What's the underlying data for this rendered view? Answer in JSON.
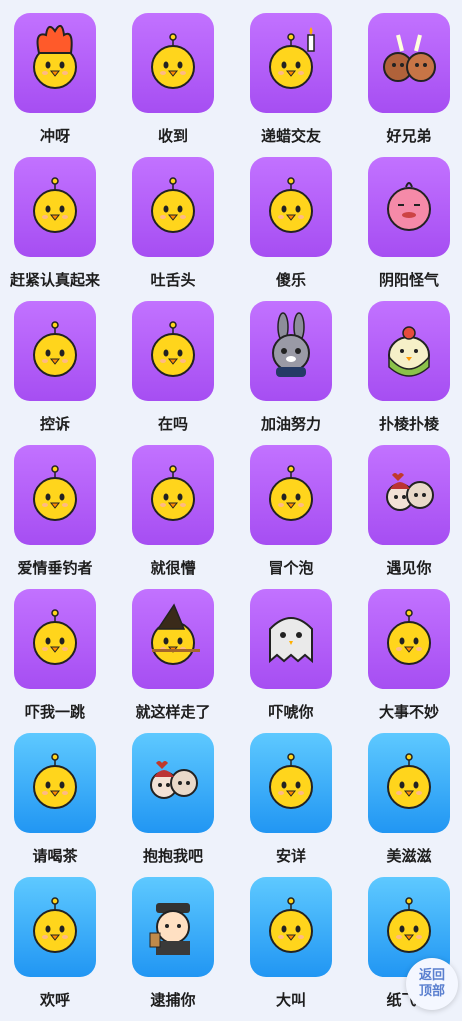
{
  "stickers": [
    {
      "label": "冲呀",
      "theme": "purple",
      "icon": "fire-chick-icon"
    },
    {
      "label": "收到",
      "theme": "purple",
      "icon": "chick-ok-icon"
    },
    {
      "label": "递蜡交友",
      "theme": "purple",
      "icon": "candle-chick-icon"
    },
    {
      "label": "好兄弟",
      "theme": "purple",
      "icon": "bear-friends-icon"
    },
    {
      "label": "赶紧认真起来",
      "theme": "purple",
      "icon": "serious-chick-icon"
    },
    {
      "label": "吐舌头",
      "theme": "purple",
      "icon": "tongue-chick-icon"
    },
    {
      "label": "傻乐",
      "theme": "purple",
      "icon": "silly-chick-icon"
    },
    {
      "label": "阴阳怪气",
      "theme": "purple",
      "icon": "pink-chick-icon"
    },
    {
      "label": "控诉",
      "theme": "purple",
      "icon": "accuse-chick-icon"
    },
    {
      "label": "在吗",
      "theme": "purple",
      "icon": "peek-chick-icon"
    },
    {
      "label": "加油努力",
      "theme": "purple",
      "icon": "bunny-icon"
    },
    {
      "label": "扑棱扑棱",
      "theme": "purple",
      "icon": "green-chick-icon"
    },
    {
      "label": "爱情垂钓者",
      "theme": "purple",
      "icon": "fishing-chick-icon"
    },
    {
      "label": "就很懵",
      "theme": "purple",
      "icon": "confused-chick-icon"
    },
    {
      "label": "冒个泡",
      "theme": "purple",
      "icon": "bubble-chick-icon"
    },
    {
      "label": "遇见你",
      "theme": "purple",
      "icon": "couple-icon"
    },
    {
      "label": "吓我一跳",
      "theme": "purple",
      "icon": "scared-chick-icon"
    },
    {
      "label": "就这样走了",
      "theme": "purple",
      "icon": "witch-chick-icon"
    },
    {
      "label": "吓唬你",
      "theme": "purple",
      "icon": "ghost-chick-icon"
    },
    {
      "label": "大事不妙",
      "theme": "purple",
      "icon": "panic-chick-icon"
    },
    {
      "label": "请喝茶",
      "theme": "blue",
      "icon": "tea-chick-icon"
    },
    {
      "label": "抱抱我吧",
      "theme": "blue",
      "icon": "hug-icon"
    },
    {
      "label": "安详",
      "theme": "blue",
      "icon": "peaceful-chick-icon"
    },
    {
      "label": "美滋滋",
      "theme": "blue",
      "icon": "happy-chick-icon"
    },
    {
      "label": "欢呼",
      "theme": "blue",
      "icon": "cheer-chick-icon"
    },
    {
      "label": "逮捕你",
      "theme": "blue",
      "icon": "detective-icon"
    },
    {
      "label": "大叫",
      "theme": "blue",
      "icon": "shout-chick-icon"
    },
    {
      "label": "纸飞机",
      "theme": "blue",
      "icon": "plane-chick-icon"
    }
  ],
  "back_to_top": {
    "line1": "返回",
    "line2": "顶部"
  },
  "colors": {
    "purple": "#b560f8",
    "blue": "#38aaf8",
    "chick": "#ffd51c"
  }
}
